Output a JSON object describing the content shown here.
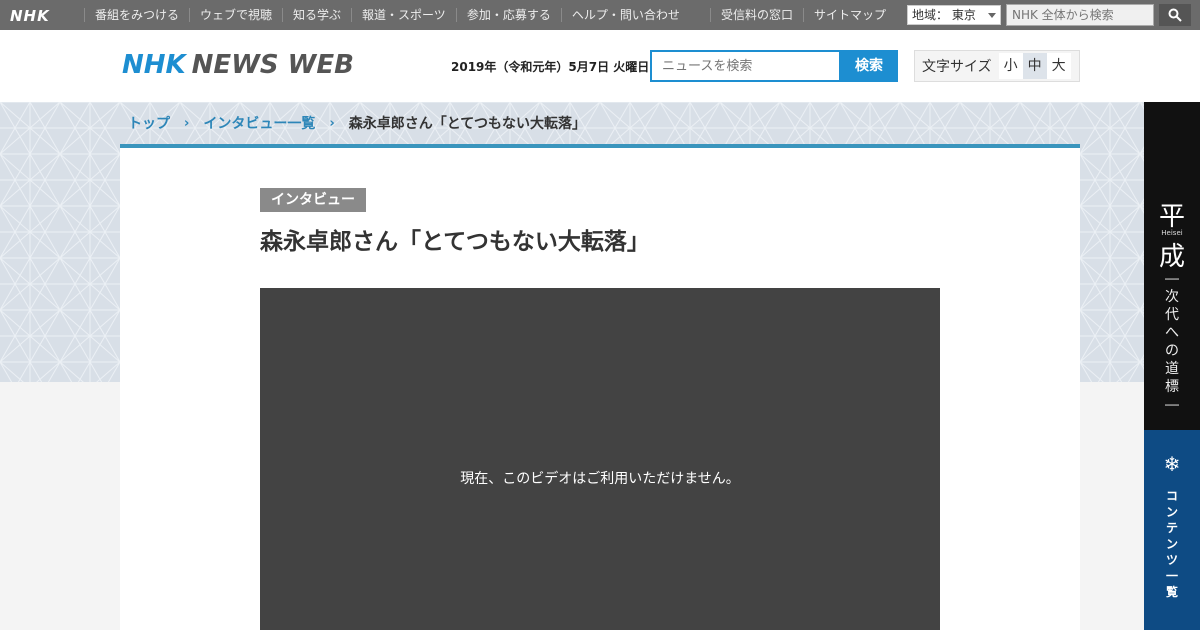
{
  "global_bar": {
    "logo": "NHK",
    "nav": [
      "番組をみつける",
      "ウェブで視聴",
      "知る学ぶ",
      "報道・スポーツ",
      "参加・応募する",
      "ヘルプ・問い合わせ"
    ],
    "right_links": [
      "受信料の窓口",
      "サイトマップ"
    ],
    "region": "地域： 東京",
    "search_placeholder": "NHK 全体から検索"
  },
  "header": {
    "logo_nhk": "NHK",
    "logo_news": "NEWS WEB",
    "date": "2019年（令和元年）5月7日 火曜日",
    "search_placeholder": "ニュースを検索",
    "search_button": "検索",
    "font_size_label": "文字サイズ",
    "font_size_options": [
      "小",
      "中",
      "大"
    ],
    "font_size_selected": "中"
  },
  "breadcrumb": {
    "items": [
      "トップ",
      "インタビュー一覧"
    ],
    "current": "森永卓郎さん「とてつもない大転落」"
  },
  "article": {
    "tag": "インタビュー",
    "title": "森永卓郎さん「とてつもない大転落」",
    "video_message": "現在、このビデオはご利用いただけません。"
  },
  "side_banners": {
    "heisei": {
      "char1": "平",
      "romaji": "Heisei",
      "char2": "成",
      "subtitle": "―次代への道標―"
    },
    "contents": {
      "label": "コンテンツ一覧"
    }
  },
  "colors": {
    "global_bar": "#6b6b6b",
    "brand_blue": "#1d8ed1",
    "breadcrumb_border": "#3a95bd",
    "video_bg": "#434343",
    "heisei_bg": "#111111",
    "contents_bg": "#0e4b84"
  }
}
